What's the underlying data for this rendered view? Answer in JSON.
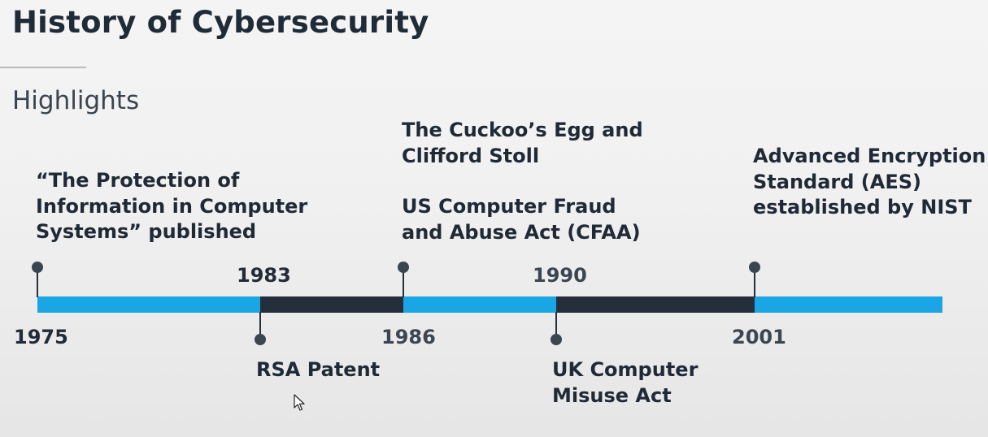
{
  "header": {
    "title": "History of Cybersecurity",
    "subtitle": "Highlights"
  },
  "timeline": {
    "years": {
      "y1975": "1975",
      "y1983": "1983",
      "y1986": "1986",
      "y1990": "1990",
      "y2001": "2001"
    },
    "events": {
      "protection": "“The Protection of\nInformation in Computer\nSystems” published",
      "cuckoo": "The Cuckoo’s Egg and\nClifford Stoll",
      "cfaa": "US Computer Fraud\nand Abuse Act (CFAA)",
      "aes": "Advanced Encryption\nStandard (AES)\nestablished by NIST",
      "rsa": "RSA Patent",
      "uk": "UK Computer\nMisuse Act"
    },
    "colors": {
      "bar_light": "#1aa6e4",
      "bar_dark": "#252f3b"
    }
  },
  "icons": {
    "cursor": "mouse-pointer-icon"
  }
}
